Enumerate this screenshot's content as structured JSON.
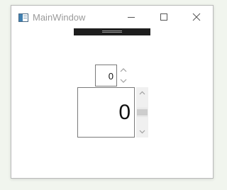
{
  "window": {
    "title": "MainWindow"
  },
  "small_updown": {
    "value": "0"
  },
  "large_updown": {
    "value": "0"
  },
  "colors": {
    "background": "#f1f5ee",
    "window": "#ffffff",
    "grip_bar": "#1e1e1e",
    "title_text": "#9a9a9a"
  },
  "icons": {
    "app": "app-window-icon",
    "minimize": "minimize-icon",
    "maximize": "maximize-icon",
    "close": "close-icon",
    "up": "chevron-up-icon",
    "down": "chevron-down-icon"
  }
}
